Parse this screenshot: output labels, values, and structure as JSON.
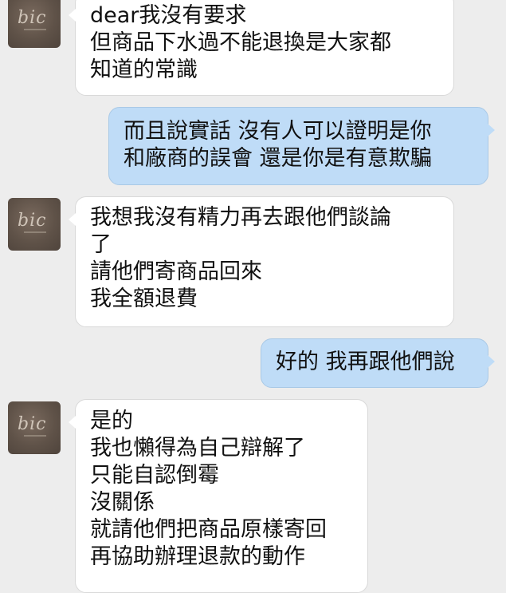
{
  "avatar": {
    "logo_text": "bic"
  },
  "messages": [
    {
      "side": "in",
      "lines": [
        "dear我沒有要求",
        "但商品下水過不能退換是大家都",
        "知道的常識"
      ]
    },
    {
      "side": "out",
      "lines": [
        "而且說實話 沒有人可以證明是你",
        "和廠商的誤會 還是你是有意欺騙"
      ]
    },
    {
      "side": "in",
      "lines": [
        "我想我沒有精力再去跟他們談論",
        "了",
        "請他們寄商品回來",
        "我全額退費"
      ]
    },
    {
      "side": "out",
      "lines": [
        "好的 我再跟他們說"
      ]
    },
    {
      "side": "in",
      "lines": [
        "是的",
        "我也懶得為自己辯解了",
        "只能自認倒霉",
        "沒關係",
        "就請他們把商品原樣寄回",
        "再協助辦理退款的動作"
      ]
    }
  ],
  "colors": {
    "background": "#ededed",
    "incoming_bubble": "#ffffff",
    "outgoing_bubble": "#bfdcf7"
  }
}
